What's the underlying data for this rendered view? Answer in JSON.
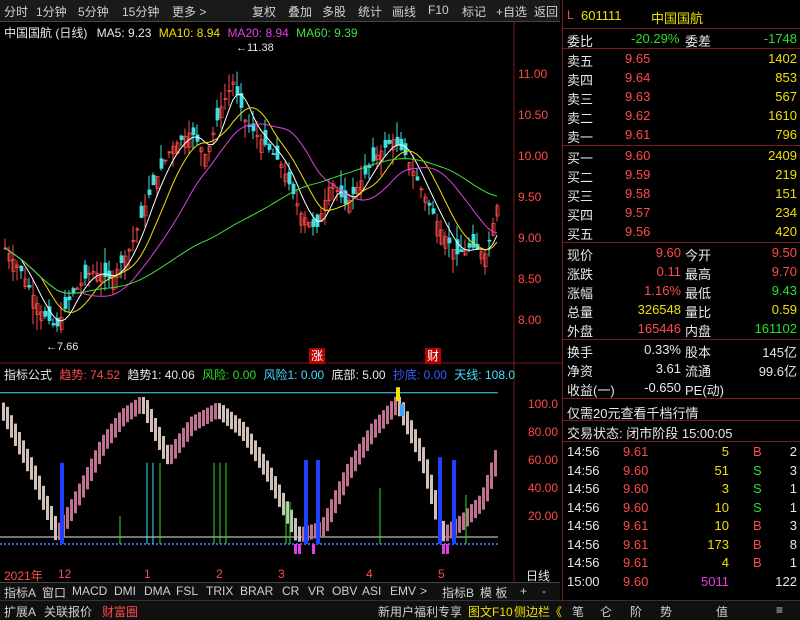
{
  "toolbar": {
    "items": [
      "分时",
      "1分钟",
      "5分钟",
      "15分钟",
      "更多 >",
      "复权",
      "叠加",
      "多股",
      "统计",
      "画线",
      "F10",
      "标记",
      "+自选",
      "返回"
    ]
  },
  "chart": {
    "title": "中国国航 (日线)",
    "ma5": "MA5: 9.23",
    "ma10": "MA10: 8.94",
    "ma20": "MA20: 8.94",
    "ma60": "MA60: 9.39",
    "high_mark": "11.38",
    "low_mark": "7.66",
    "y_ticks": [
      "11.00",
      "10.50",
      "10.00",
      "9.50",
      "9.00",
      "8.50",
      "8.00"
    ],
    "badge_zhang": "涨",
    "badge_cai": "财"
  },
  "indicator": {
    "name": "指标公式",
    "trend_label": "趋势: 74.52",
    "trend1_label": "趋势1: 40.06",
    "risk_label": "风险: 0.00",
    "risk1_label": "风险1: 0.00",
    "bottom_label": "底部: 5.00",
    "bottom2_label": "抄底: 0.00",
    "sky_label": "天线: 108.0",
    "y_ticks": [
      "100.0",
      "80.00",
      "60.00",
      "40.00",
      "20.00"
    ]
  },
  "time_axis": {
    "labels": [
      "2021年",
      "12",
      "1",
      "2",
      "3",
      "4",
      "5"
    ],
    "day_label": "日线"
  },
  "tabs": [
    "指标A",
    "窗口",
    "MACD",
    "DMI",
    "DMA",
    "FSL",
    "TRIX",
    "BRAR",
    "CR",
    "VR",
    "OBV",
    "ASI",
    "EMV",
    ">",
    "指标B",
    "模 板",
    "+",
    "-"
  ],
  "bottom_bar": {
    "left": [
      "扩展A",
      "关联报价",
      "财富圈"
    ],
    "right": [
      "新用户福利专享",
      "图文F10",
      "侧边栏《"
    ],
    "side": [
      "笔",
      "仑",
      "阶",
      "势",
      "值",
      "≡"
    ]
  },
  "quote": {
    "code": "601111",
    "name": "中国国航",
    "weibi_label": "委比",
    "weibi_value": "-20.29%",
    "weicha_label": "委差",
    "weicha_value": "-1748",
    "sells": [
      {
        "label": "卖五",
        "price": "9.65",
        "vol": "1402"
      },
      {
        "label": "卖四",
        "price": "9.64",
        "vol": "853"
      },
      {
        "label": "卖三",
        "price": "9.63",
        "vol": "567"
      },
      {
        "label": "卖二",
        "price": "9.62",
        "vol": "1610"
      },
      {
        "label": "卖一",
        "price": "9.61",
        "vol": "796"
      }
    ],
    "buys": [
      {
        "label": "买一",
        "price": "9.60",
        "vol": "2409"
      },
      {
        "label": "买二",
        "price": "9.59",
        "vol": "219"
      },
      {
        "label": "买三",
        "price": "9.58",
        "vol": "151"
      },
      {
        "label": "买四",
        "price": "9.57",
        "vol": "234"
      },
      {
        "label": "买五",
        "price": "9.56",
        "vol": "420"
      }
    ],
    "stats": [
      {
        "l1": "现价",
        "v1": "9.60",
        "l2": "今开",
        "v2": "9.50"
      },
      {
        "l1": "涨跌",
        "v1": "0.11",
        "l2": "最高",
        "v2": "9.70"
      },
      {
        "l1": "涨幅",
        "v1": "1.16%",
        "l2": "最低",
        "v2": "9.43"
      },
      {
        "l1": "总量",
        "v1": "326548",
        "l2": "量比",
        "v2": "0.59"
      },
      {
        "l1": "外盘",
        "v1": "165446",
        "l2": "内盘",
        "v2": "161102"
      }
    ],
    "stats2": [
      {
        "l1": "换手",
        "v1": "0.33%",
        "l2": "股本",
        "v2": "145亿"
      },
      {
        "l1": "净资",
        "v1": "3.61",
        "l2": "流通",
        "v2": "99.6亿"
      },
      {
        "l1": "收益(一)",
        "v1": "-0.650",
        "l2": "PE(动)",
        "v2": ""
      }
    ],
    "promo": "仅需20元查看千档行情",
    "status": "交易状态: 闭市阶段 15:00:05",
    "ticks": [
      {
        "t": "14:56",
        "p": "9.61",
        "v": "5",
        "s": "B",
        "n": "2"
      },
      {
        "t": "14:56",
        "p": "9.60",
        "v": "51",
        "s": "S",
        "n": "3"
      },
      {
        "t": "14:56",
        "p": "9.60",
        "v": "3",
        "s": "S",
        "n": "1"
      },
      {
        "t": "14:56",
        "p": "9.60",
        "v": "10",
        "s": "S",
        "n": "1"
      },
      {
        "t": "14:56",
        "p": "9.61",
        "v": "10",
        "s": "B",
        "n": "3"
      },
      {
        "t": "14:56",
        "p": "9.61",
        "v": "173",
        "s": "B",
        "n": "8"
      },
      {
        "t": "14:56",
        "p": "9.61",
        "v": "4",
        "s": "B",
        "n": "1"
      },
      {
        "t": "15:00",
        "p": "9.60",
        "v": "5011",
        "s": "",
        "n": "122"
      }
    ]
  }
}
